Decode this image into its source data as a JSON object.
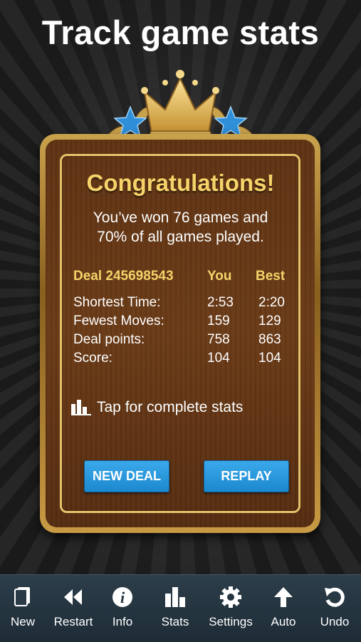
{
  "headline": "Track game stats",
  "dialog": {
    "title": "Congratulations!",
    "message_line1": "You’ve won 76 games and",
    "message_line2": "70% of all games played.",
    "table": {
      "deal_label": "Deal 245698543",
      "col_you": "You",
      "col_best": "Best",
      "rows": [
        {
          "label": "Shortest Time:",
          "you": "2:53",
          "best": "2:20"
        },
        {
          "label": "Fewest Moves:",
          "you": "159",
          "best": "129"
        },
        {
          "label": "Deal points:",
          "you": "758",
          "best": "863"
        },
        {
          "label": "Score:",
          "you": "104",
          "best": "104"
        }
      ]
    },
    "stats_link": "Tap for complete stats",
    "new_deal_button": "NEW DEAL",
    "replay_button": "REPLAY"
  },
  "toolbar": {
    "items": [
      {
        "label": "New",
        "icon": "cards-icon"
      },
      {
        "label": "Restart",
        "icon": "rewind-icon"
      },
      {
        "label": "Info",
        "icon": "info-icon"
      },
      {
        "label": "Stats",
        "icon": "bar-chart-icon"
      },
      {
        "label": "Settings",
        "icon": "gear-icon"
      },
      {
        "label": "Auto",
        "icon": "arrow-up-icon"
      },
      {
        "label": "Undo",
        "icon": "undo-icon"
      }
    ]
  },
  "colors": {
    "accent_gold": "#f5d36a",
    "button_blue": "#2b9de0",
    "wood": "#5e3212",
    "toolbar": "#243541"
  }
}
